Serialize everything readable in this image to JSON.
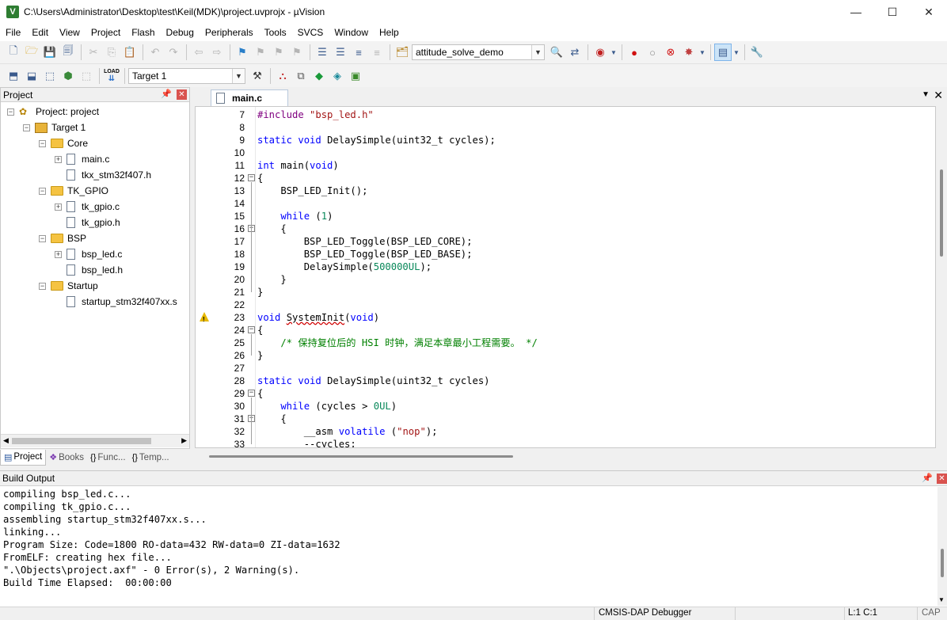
{
  "window": {
    "title": "C:\\Users\\Administrator\\Desktop\\test\\Keil(MDK)\\project.uvprojx - µVision",
    "app_icon_letter": "V",
    "minimize": "—",
    "maximize": "☐",
    "close": "✕"
  },
  "menu": [
    "File",
    "Edit",
    "View",
    "Project",
    "Flash",
    "Debug",
    "Peripherals",
    "Tools",
    "SVCS",
    "Window",
    "Help"
  ],
  "toolbar": {
    "project_combo": "attitude_solve_demo",
    "target_combo": "Target 1",
    "load_label": "LOAD"
  },
  "project_panel": {
    "title": "Project",
    "pin": "📌",
    "close": "✕",
    "tree": {
      "root": "Project: project",
      "target": "Target 1",
      "groups": [
        {
          "name": "Core",
          "files": [
            {
              "name": "main.c",
              "expandable": true
            },
            {
              "name": "tkx_stm32f407.h",
              "expandable": false
            }
          ]
        },
        {
          "name": "TK_GPIO",
          "files": [
            {
              "name": "tk_gpio.c",
              "expandable": true
            },
            {
              "name": "tk_gpio.h",
              "expandable": false
            }
          ]
        },
        {
          "name": "BSP",
          "files": [
            {
              "name": "bsp_led.c",
              "expandable": true
            },
            {
              "name": "bsp_led.h",
              "expandable": false
            }
          ]
        },
        {
          "name": "Startup",
          "files": [
            {
              "name": "startup_stm32f407xx.s",
              "expandable": false
            }
          ]
        }
      ]
    },
    "bottom_tabs": [
      {
        "label": "Project",
        "icon": "project-icon"
      },
      {
        "label": "Books",
        "icon": "books-icon"
      },
      {
        "label": "Func...",
        "icon": "functions-icon"
      },
      {
        "label": "Temp...",
        "icon": "templates-icon"
      }
    ]
  },
  "editor": {
    "tab_label": "main.c",
    "lines": [
      {
        "n": "7",
        "tokens": [
          [
            "pp",
            "#include "
          ],
          [
            "str",
            "\"bsp_led.h\""
          ]
        ]
      },
      {
        "n": "8",
        "tokens": []
      },
      {
        "n": "9",
        "tokens": [
          [
            "kw",
            "static void "
          ],
          [
            "",
            "DelaySimple(uint32_t cycles);"
          ]
        ]
      },
      {
        "n": "10",
        "tokens": []
      },
      {
        "n": "11",
        "tokens": [
          [
            "kw",
            "int "
          ],
          [
            "",
            "main("
          ],
          [
            "kw",
            "void"
          ],
          [
            "",
            ")"
          ]
        ]
      },
      {
        "n": "12",
        "tokens": [
          [
            "",
            "{"
          ]
        ],
        "fold": "open"
      },
      {
        "n": "13",
        "tokens": [
          [
            "",
            "    BSP_LED_Init();"
          ]
        ]
      },
      {
        "n": "14",
        "tokens": []
      },
      {
        "n": "15",
        "tokens": [
          [
            "kw",
            "    while "
          ],
          [
            "",
            "("
          ],
          [
            "num",
            "1"
          ],
          [
            "",
            ")"
          ]
        ]
      },
      {
        "n": "16",
        "tokens": [
          [
            "",
            "    {"
          ]
        ],
        "fold": "open"
      },
      {
        "n": "17",
        "tokens": [
          [
            "",
            "        BSP_LED_Toggle(BSP_LED_CORE);"
          ]
        ]
      },
      {
        "n": "18",
        "tokens": [
          [
            "",
            "        BSP_LED_Toggle(BSP_LED_BASE);"
          ]
        ]
      },
      {
        "n": "19",
        "tokens": [
          [
            "",
            "        DelaySimple("
          ],
          [
            "num",
            "500000UL"
          ],
          [
            "",
            ");"
          ]
        ]
      },
      {
        "n": "20",
        "tokens": [
          [
            "",
            "    }"
          ]
        ]
      },
      {
        "n": "21",
        "tokens": [
          [
            "",
            "}"
          ]
        ]
      },
      {
        "n": "22",
        "tokens": []
      },
      {
        "n": "23",
        "tokens": [
          [
            "kw",
            "void "
          ],
          [
            "wavy",
            "SystemInit"
          ],
          [
            "",
            "("
          ],
          [
            "kw",
            "void"
          ],
          [
            "",
            ")"
          ]
        ],
        "warning": true
      },
      {
        "n": "24",
        "tokens": [
          [
            "",
            "{"
          ]
        ],
        "fold": "open"
      },
      {
        "n": "25",
        "tokens": [
          [
            "cmt",
            "    /* 保持复位后的 HSI 时钟，满足本章最小工程需要。 */"
          ]
        ]
      },
      {
        "n": "26",
        "tokens": [
          [
            "",
            "}"
          ]
        ]
      },
      {
        "n": "27",
        "tokens": []
      },
      {
        "n": "28",
        "tokens": [
          [
            "kw",
            "static void "
          ],
          [
            "",
            "DelaySimple(uint32_t cycles)"
          ]
        ]
      },
      {
        "n": "29",
        "tokens": [
          [
            "",
            "{"
          ]
        ],
        "fold": "open"
      },
      {
        "n": "30",
        "tokens": [
          [
            "kw",
            "    while "
          ],
          [
            "",
            "(cycles > "
          ],
          [
            "num",
            "0UL"
          ],
          [
            "",
            ")"
          ]
        ]
      },
      {
        "n": "31",
        "tokens": [
          [
            "",
            "    {"
          ]
        ],
        "fold": "open"
      },
      {
        "n": "32",
        "tokens": [
          [
            "",
            "        __asm "
          ],
          [
            "kw",
            "volatile "
          ],
          [
            "",
            "("
          ],
          [
            "str",
            "\"nop\""
          ],
          [
            "",
            ");"
          ]
        ]
      },
      {
        "n": "33",
        "tokens": [
          [
            "",
            "        --cycles;"
          ]
        ]
      }
    ]
  },
  "build_output": {
    "title": "Build Output",
    "lines": [
      "compiling bsp_led.c...",
      "compiling tk_gpio.c...",
      "assembling startup_stm32f407xx.s...",
      "linking...",
      "Program Size: Code=1800 RO-data=432 RW-data=0 ZI-data=1632",
      "FromELF: creating hex file...",
      "\".\\Objects\\project.axf\" - 0 Error(s), 2 Warning(s).",
      "Build Time Elapsed:  00:00:00"
    ]
  },
  "statusbar": {
    "debugger": "CMSIS-DAP Debugger",
    "position": "L:1 C:1",
    "caps": "CAP"
  }
}
